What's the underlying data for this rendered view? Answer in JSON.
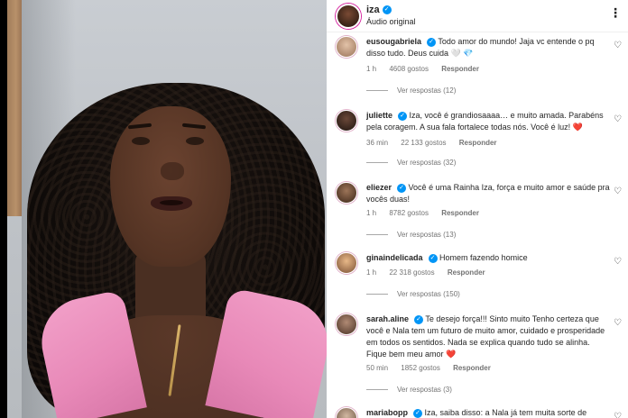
{
  "header": {
    "username": "iza",
    "verified_mark": "✓",
    "subtitle": "Áudio original",
    "more_icon": "more-horizontal-icon"
  },
  "comments": [
    {
      "username": "eusougabriela",
      "verified": true,
      "text": "Todo amor do mundo! Jaja vc entende o pq disso tudo. Deus cuida 🤍 💎",
      "time": "1 h",
      "likes": "4608 gostos",
      "reply_label": "Responder",
      "view_replies": "Ver respostas (12)",
      "avatar_color": "#c9a184"
    },
    {
      "username": "juliette",
      "verified": true,
      "text": "Iza, você é grandiosaaaa… e muito amada. Parabéns pela coragem. A sua fala fortalece todas nós. Você é luz! ❤️",
      "time": "36 min",
      "likes": "22 133 gostos",
      "reply_label": "Responder",
      "view_replies": "Ver respostas (32)",
      "avatar_color": "#3b2a22"
    },
    {
      "username": "eliezer",
      "verified": true,
      "text": "Você é uma Rainha Iza, força e muito amor e saúde pra vocês duas!",
      "time": "1 h",
      "likes": "8782 gostos",
      "reply_label": "Responder",
      "view_replies": "Ver respostas (13)",
      "avatar_color": "#6b4a36"
    },
    {
      "username": "ginaindelicada",
      "verified": true,
      "text": "Homem fazendo homice",
      "time": "1 h",
      "likes": "22 318 gostos",
      "reply_label": "Responder",
      "view_replies": "Ver respostas (150)",
      "avatar_color": "#d8a070"
    },
    {
      "username": "sarah.aline",
      "verified": true,
      "text": "Te desejo força!!! Sinto muito Tenho certeza que você e Nala tem um futuro de muito amor, cuidado e prosperidade em todos os sentidos. Nada se explica quando tudo se alinha. Fique bem meu amor ❤️",
      "time": "50 min",
      "likes": "1852 gostos",
      "reply_label": "Responder",
      "view_replies": "Ver respostas (3)",
      "avatar_color": "#8a6a58"
    },
    {
      "username": "mariabopp",
      "verified": true,
      "text": "Iza, saiba disso: a Nala já tem muita sorte de",
      "avatar_color": "#b49a84"
    }
  ],
  "icons": {
    "heart": "♡",
    "more": "⋮"
  },
  "colors": {
    "verified_blue": "#0095f6",
    "meta_gray": "#737373",
    "red_heart": "#ed4956"
  }
}
